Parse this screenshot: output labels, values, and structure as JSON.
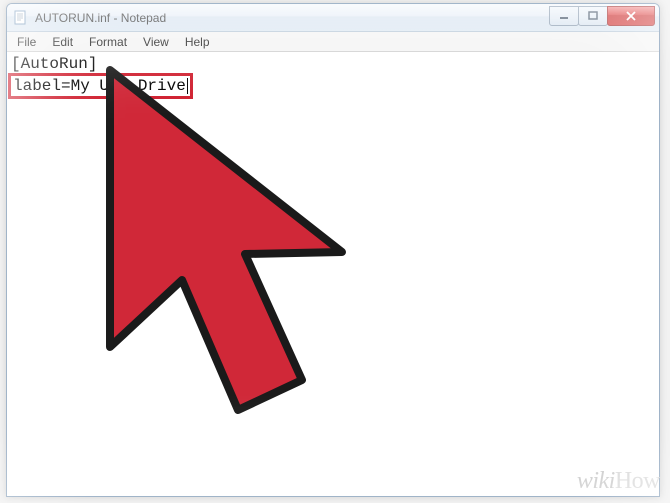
{
  "window": {
    "title": "AUTORUN.inf - Notepad"
  },
  "menu": {
    "file": "File",
    "edit": "Edit",
    "format": "Format",
    "view": "View",
    "help": "Help"
  },
  "content": {
    "line1": "[AutoRun]",
    "line2": "label=My USB Drive"
  },
  "watermark": {
    "part1": "wiki",
    "part2": "How"
  }
}
